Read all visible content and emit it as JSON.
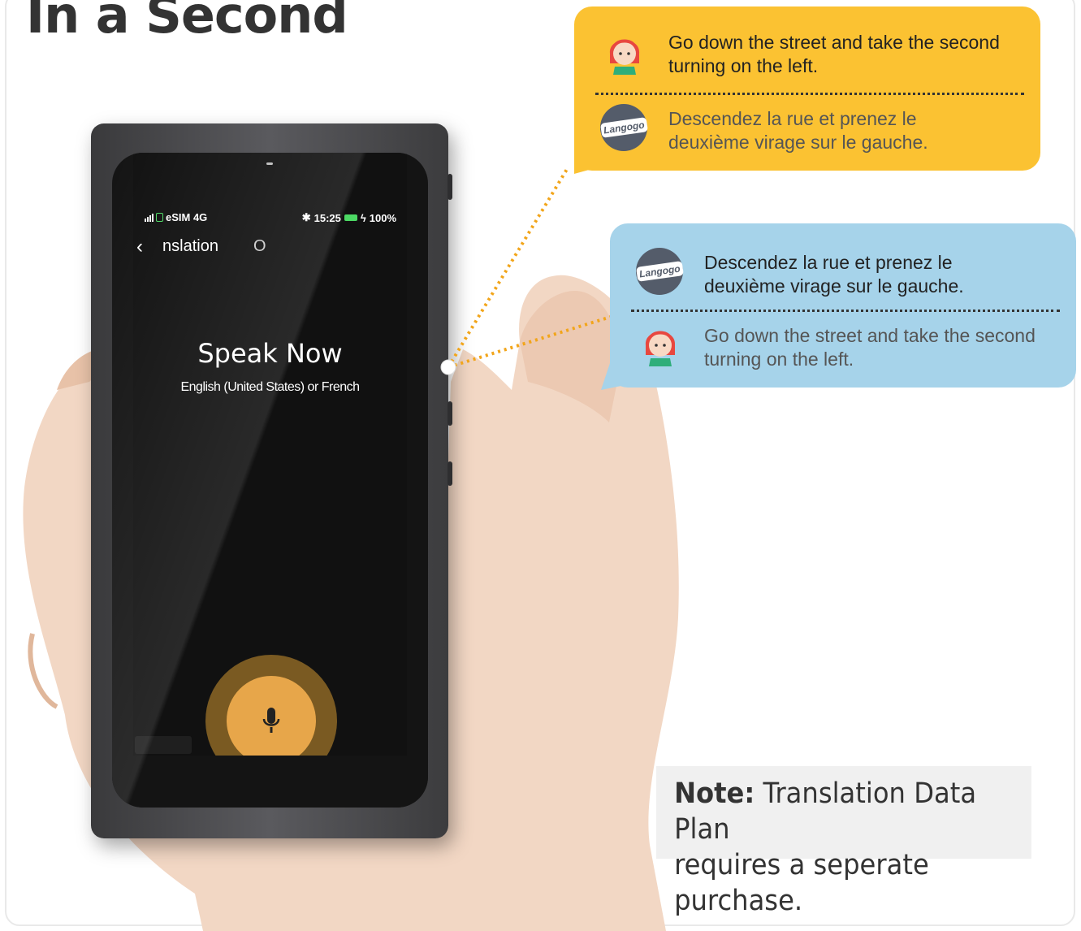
{
  "headline": "In a Second",
  "phone": {
    "status": {
      "network": "eSIM 4G",
      "time": "15:25",
      "battery": "100%"
    },
    "nav": {
      "back_icon": "chevron-left-icon",
      "title": "nslation",
      "secondary": "O"
    },
    "prompt": "Speak Now",
    "languages": "English (United States) or French",
    "mic_icon": "microphone-icon"
  },
  "bubble_top": {
    "line1": "Go down the street and take the second",
    "line2": "turning on the left.",
    "line3": "Descendez la rue et prenez le",
    "line4": "deuxième virage sur le gauche.",
    "logo": "Langogo"
  },
  "bubble_bottom": {
    "line1": "Descendez la rue et prenez le",
    "line2": "deuxième virage sur le gauche.",
    "line3": "Go down the street and take the second",
    "line4": "turning on the left.",
    "logo": "Langogo"
  },
  "note": {
    "label": "Note:",
    "text1": " Translation Data Plan",
    "text2": "requires a seperate purchase."
  },
  "colors": {
    "yellow_bubble": "#fbc232",
    "blue_bubble": "#a6d3ea",
    "mic_accent": "#e7a64a",
    "heading": "#333333"
  }
}
